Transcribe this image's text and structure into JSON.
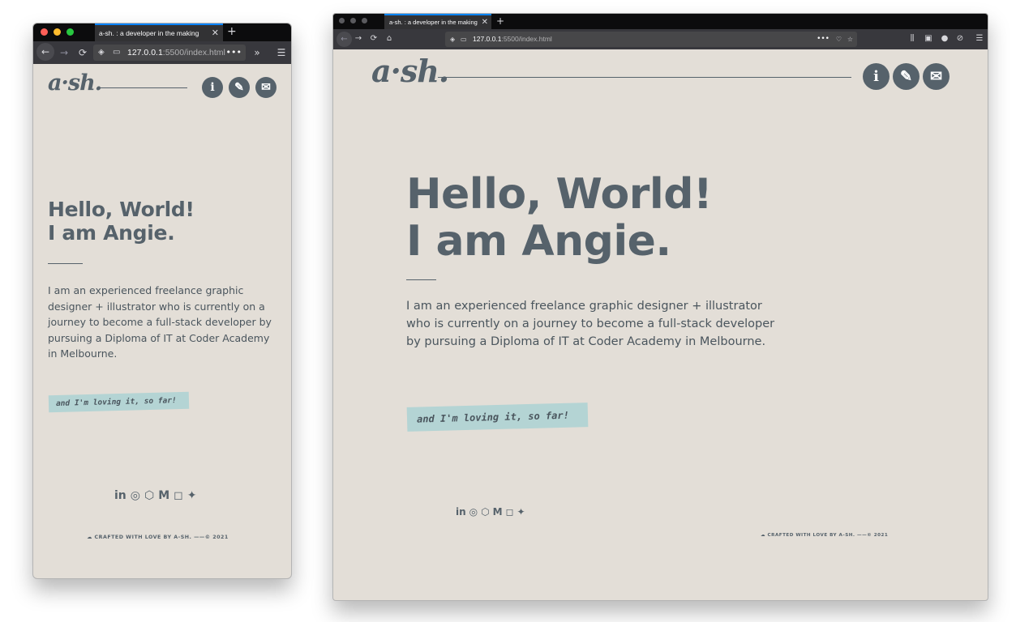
{
  "browser": {
    "tab_title": "a-sh. : a developer in the making",
    "tab_close": "✕",
    "new_tab": "+",
    "url_host": "127.0.0.1",
    "url_path": ":5500/index.html",
    "icons": {
      "back": "←",
      "forward": "→",
      "reload": "⟳",
      "home": "⌂",
      "shield": "◈",
      "page": "▭",
      "more": "•••",
      "overflow": "»",
      "menu": "☰",
      "pocket": "♡",
      "bookmark": "☆",
      "library": "⫼",
      "sidebar": "▣",
      "account": "●",
      "extension": "⊘"
    },
    "traffic_lights": [
      "#ff5f57",
      "#febc2e",
      "#28c840"
    ],
    "traffic_lights_inactive": [
      "#5a5a5e",
      "#5a5a5e",
      "#5a5a5e"
    ]
  },
  "site": {
    "logo": "a·sh.",
    "nav_icons": [
      {
        "name": "info-icon",
        "glyph": "i"
      },
      {
        "name": "pencil-icon",
        "glyph": "✎"
      },
      {
        "name": "mail-icon",
        "glyph": "✉"
      }
    ],
    "heading_line1": "Hello, World!",
    "heading_line2": "I am Angie.",
    "intro": "I am an experienced freelance graphic designer + illustrator who is currently on a journey to become a full-stack developer by pursuing a Diploma of IT at Coder Academy in Melbourne.",
    "tag": "and I'm loving it, so far!",
    "socials": [
      {
        "name": "linkedin-icon",
        "glyph": "in"
      },
      {
        "name": "github-icon",
        "glyph": "◎"
      },
      {
        "name": "codepen-icon",
        "glyph": "⬡"
      },
      {
        "name": "medium-icon",
        "glyph": "M"
      },
      {
        "name": "instagram-icon",
        "glyph": "◻"
      },
      {
        "name": "twitter-icon",
        "glyph": "✦"
      }
    ],
    "footer": "☁ CRAFTED WITH LOVE BY A-SH. ——© 2021"
  },
  "colors": {
    "page_bg": "#e3ded7",
    "text_primary": "#56626b",
    "tag_bg": "#b4d4d4",
    "tab_accent": "#0a84ff",
    "toolbar_dark": "#0c0c0d",
    "toolbar": "#38383d"
  }
}
